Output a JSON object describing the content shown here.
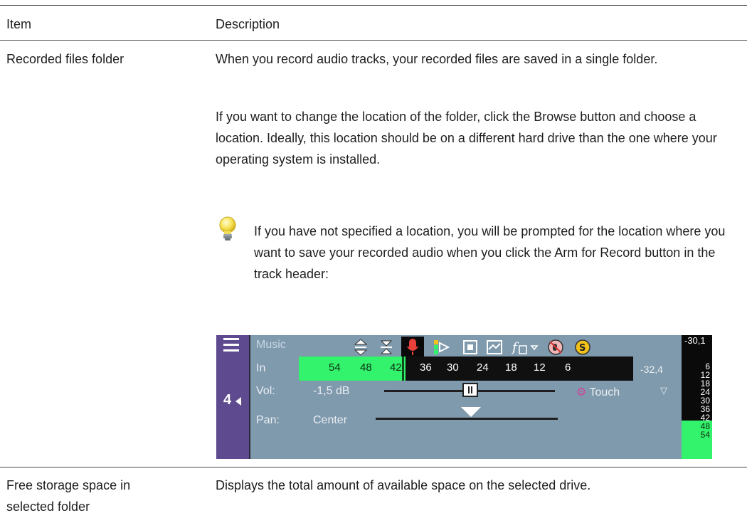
{
  "table": {
    "headers": {
      "item": "Item",
      "description": "Description"
    },
    "rows": [
      {
        "item": "Recorded files folder",
        "paragraphs": [
          "When you record audio tracks, your recorded files are saved in a single folder.",
          "If you want to change the location of the folder, click the Browse button and choose a location. Ideally, this location should be on a different hard drive than the one where your operating system is installed."
        ],
        "tip": "If you have not specified a location, you will be prompted for the location where you want to save your recorded audio when you click the Arm for Record button in the track header:",
        "tip_icon": "lightbulb-icon"
      },
      {
        "item_line1": "Free storage space in",
        "item_line2": "selected folder",
        "description": "Displays the total amount of available space on the selected drive."
      }
    ]
  },
  "track_header": {
    "track_name": "Music",
    "track_number": "4",
    "in_label": "In",
    "vol_label": "Vol:",
    "vol_value": "-1,5 dB",
    "pan_label": "Pan:",
    "pan_value": "Center",
    "automation_mode": "Touch",
    "meter_scale": [
      "54",
      "48",
      "42",
      "36",
      "30",
      "24",
      "18",
      "12",
      "6"
    ],
    "meter_peak": "-32,4",
    "right_meter_top": "-30,1",
    "right_meter_scale": [
      "6",
      "12",
      "18",
      "24",
      "30",
      "36",
      "42",
      "48",
      "54"
    ],
    "icons": [
      "move-up-down-icon",
      "minimize-icon",
      "microphone-arm-icon",
      "input-monitor-icon",
      "fx-bypass-icon",
      "automation-icon",
      "fx-chain-icon",
      "mute-icon",
      "solo-icon"
    ],
    "colors": {
      "meter_green": "#33f26b",
      "header_bg": "#7f99ad",
      "side_bar": "#5e4a8e",
      "arm_red": "#e8413a"
    }
  }
}
